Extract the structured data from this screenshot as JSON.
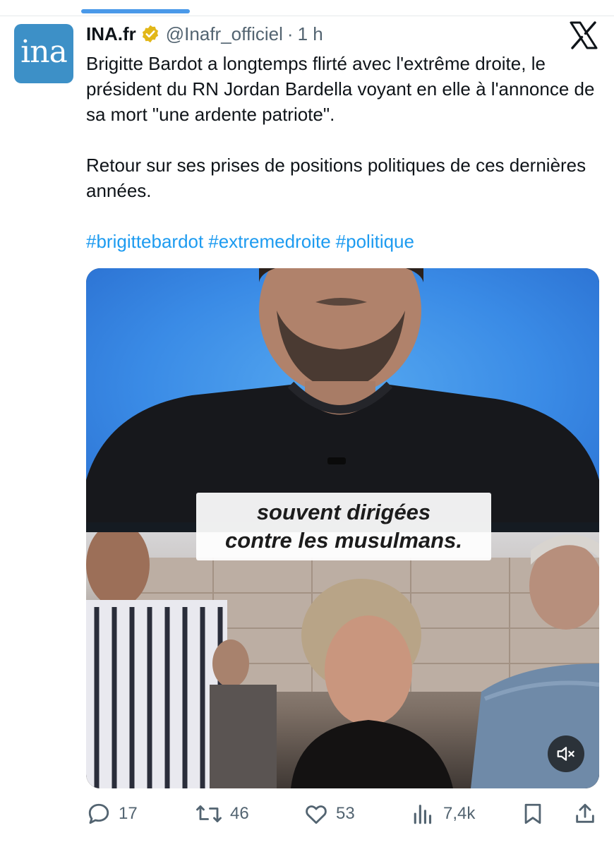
{
  "tweet": {
    "author_name": "INA.fr",
    "handle": "@Inafr_officiel",
    "separator": "·",
    "time": "1 h",
    "avatar_text": "ina",
    "paragraph1": "Brigitte Bardot a longtemps flirté avec l'extrême droite, le président du RN Jordan Bardella voyant en elle à l'annonce de sa mort \"une ardente patriote\".",
    "paragraph2": "Retour sur ses prises de positions politiques de ces dernières années.",
    "hashtags": [
      "#brigittebardot",
      "#extremedroite",
      "#politique"
    ]
  },
  "media": {
    "caption_line1": "souvent dirigées",
    "caption_line2": "contre les musulmans."
  },
  "actions": {
    "replies": "17",
    "reposts": "46",
    "likes": "53",
    "views": "7,4k"
  },
  "icons": {
    "verified": "verified-badge-icon",
    "x_logo": "x-logo-icon",
    "mute": "speaker-muted-icon",
    "reply": "reply-icon",
    "repost": "repost-icon",
    "like": "heart-icon",
    "views": "views-icon",
    "bookmark": "bookmark-icon",
    "share": "share-icon"
  },
  "colors": {
    "accent": "#1d9bf0",
    "secondary_text": "#536471",
    "verified": "#e2b719",
    "avatar_bg": "#3d90c7"
  }
}
